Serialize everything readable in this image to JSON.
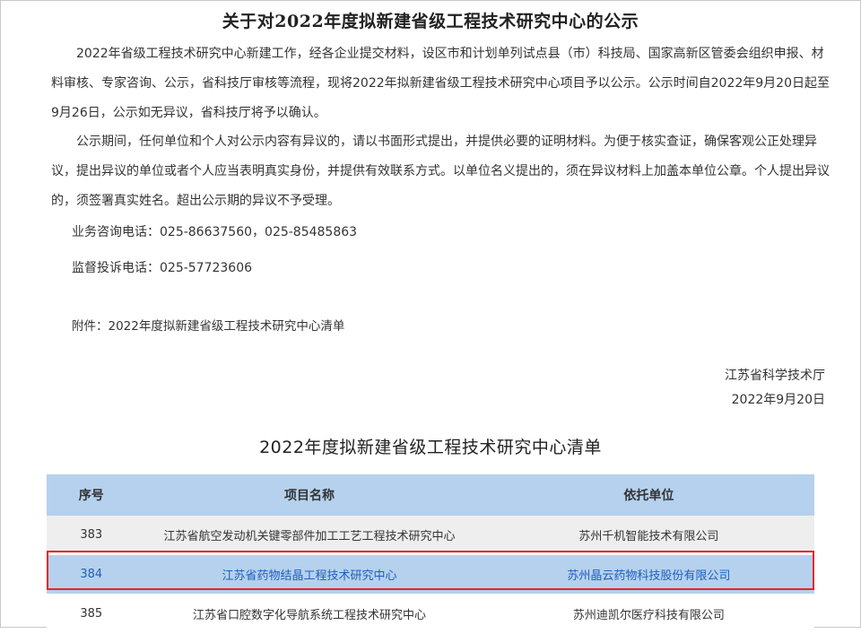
{
  "notice": {
    "title": "关于对2022年度拟新建省级工程技术研究中心的公示",
    "paragraph1": "2022年省级工程技术研究中心新建工作，经各企业提交材料，设区市和计划单列试点县（市）科技局、国家高新区管委会组织申报、材料审核、专家咨询、公示，省科技厅审核等流程，现将2022年拟新建省级工程技术研究中心项目予以公示。公示时间自2022年9月20日起至9月26日，公示如无异议，省科技厅将予以确认。",
    "paragraph2": "公示期间，任何单位和个人对公示内容有异议的，请以书面形式提出，并提供必要的证明材料。为便于核实查证，确保客观公正处理异议，提出异议的单位或者个人应当表明真实身份，并提供有效联系方式。以单位名义提出的，须在异议材料上加盖本单位公章。个人提出异议的，须签署真实姓名。超出公示期的异议不予受理。",
    "phone_line": "业务咨询电话：025-86637560，025-85485863",
    "complaint_line": "监督投诉电话：025-57723606",
    "attachment_line": "附件：2022年度拟新建省级工程技术研究中心清单",
    "signature_org": "江苏省科学技术厅",
    "signature_date": "2022年9月20日"
  },
  "list": {
    "title": "2022年度拟新建省级工程技术研究中心清单",
    "headers": [
      "序号",
      "项目名称",
      "依托单位"
    ],
    "rows": [
      [
        "383",
        "江苏省航空发动机关键零部件加工工艺工程技术研究中心",
        "苏州千机智能技术有限公司"
      ],
      [
        "384",
        "江苏省药物结晶工程技术研究中心",
        "苏州晶云药物科技股份有限公司"
      ],
      [
        "385",
        "江苏省口腔数字化导航系统工程技术研究中心",
        "苏州迪凯尔医疗科技有限公司"
      ]
    ],
    "highlighted_row": "384",
    "highlight_color": "#e8232a",
    "header_color": "#b5d1ed",
    "link_color": "#1f5fbe"
  }
}
